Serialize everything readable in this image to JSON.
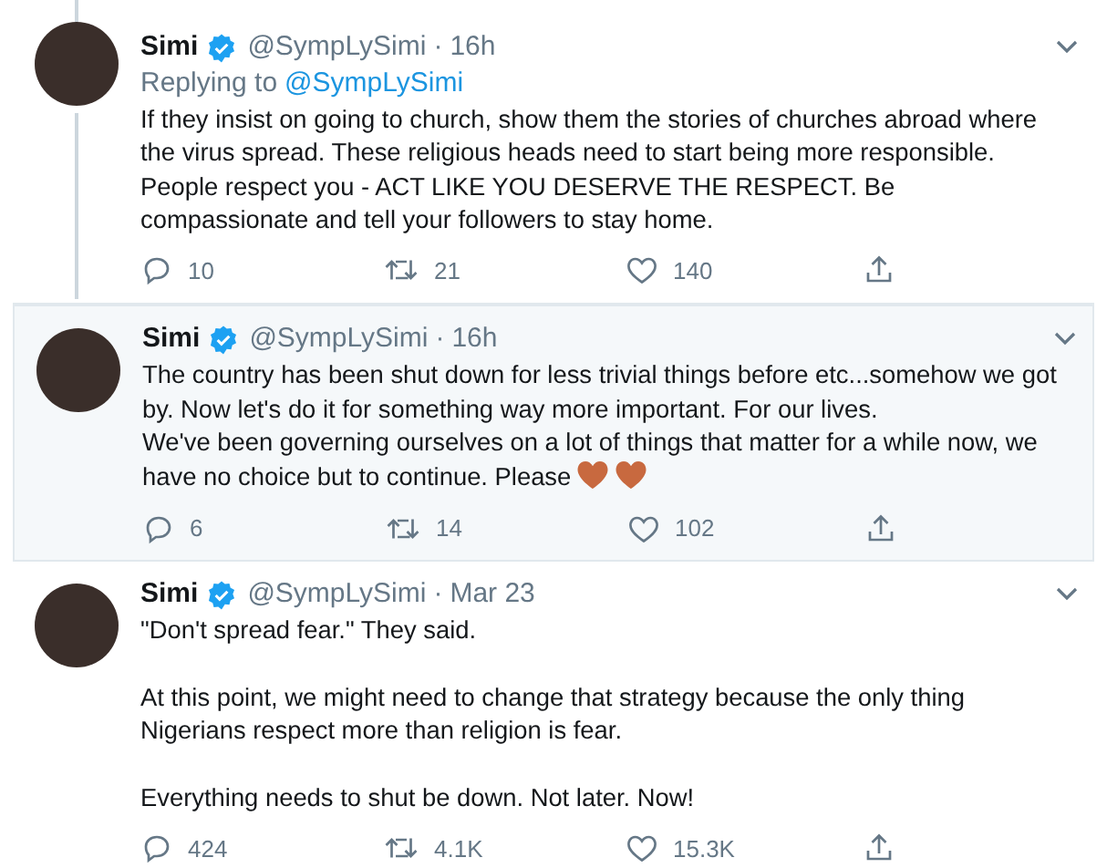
{
  "tweets": [
    {
      "author": "Simi",
      "verified": true,
      "handle": "@SympLySimi",
      "separator": "·",
      "time": "16h",
      "thread_above": true,
      "thread_below": true,
      "highlighted": false,
      "replying_label": "Replying to",
      "replying_to": "@SympLySimi",
      "text": "If they insist on going to church, show them the stories of churches abroad where the virus spread. These religious heads need to start being more responsible. People respect you - ACT LIKE YOU DESERVE THE RESPECT. Be compassionate and tell your followers to stay home.",
      "replies": "10",
      "retweets": "21",
      "likes": "140"
    },
    {
      "author": "Simi",
      "verified": true,
      "handle": "@SympLySimi",
      "separator": "·",
      "time": "16h",
      "thread_above": false,
      "thread_below": false,
      "highlighted": true,
      "text": "The country has been shut down for less trivial things before etc...somehow we got by. Now let's do it for something way more important. For our lives.\nWe've been governing ourselves on a lot of things that matter for a while now, we have no choice but to continue. Please",
      "emojis": [
        {
          "kind": "heart"
        },
        {
          "kind": "heart"
        }
      ],
      "replies": "6",
      "retweets": "14",
      "likes": "102"
    },
    {
      "author": "Simi",
      "verified": true,
      "handle": "@SympLySimi",
      "separator": "·",
      "time": "Mar 23",
      "thread_above": false,
      "thread_below": false,
      "highlighted": false,
      "text": "\"Don't spread fear.\" They said.\n\nAt this point, we might need to change that strategy because the only thing Nigerians respect more than religion is fear.\n\nEverything needs to shut be down. Not later. Now!",
      "replies": "424",
      "retweets": "4.1K",
      "likes": "15.3K"
    }
  ]
}
